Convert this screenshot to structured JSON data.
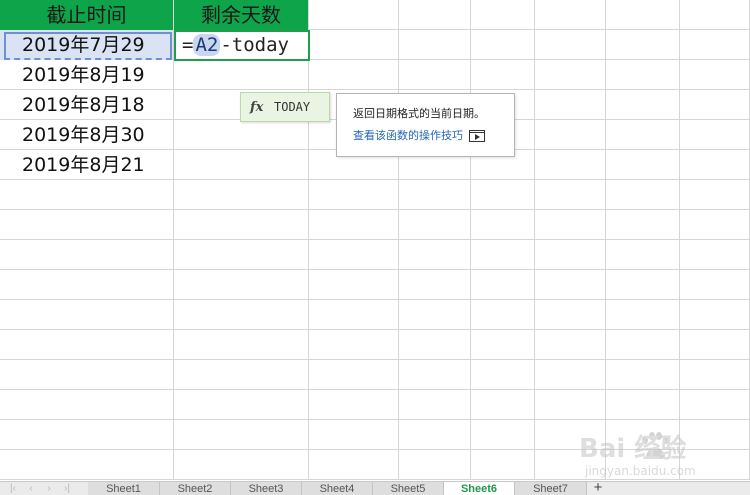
{
  "spreadsheet": {
    "headers": {
      "col_a": "截止时间",
      "col_b": "剩余天数"
    },
    "dates": [
      "2019年7月29",
      "2019年8月19",
      "2019年8月18",
      "2019年8月30",
      "2019年8月21"
    ],
    "formula": {
      "equals": "=",
      "ref": "A2",
      "rest": "-today"
    }
  },
  "autocomplete": {
    "fx_symbol": "fx",
    "function_name": "TODAY"
  },
  "tooltip": {
    "description": "返回日期格式的当前日期。",
    "link_text": "查看该函数的操作技巧"
  },
  "sheet_tabs": [
    "Sheet1",
    "Sheet2",
    "Sheet3",
    "Sheet4",
    "Sheet5",
    "Sheet6",
    "Sheet7"
  ],
  "active_sheet": "Sheet6",
  "add_sheet_symbol": "+",
  "watermark": {
    "brand": "Bai 经验",
    "url": "jingyan.baidu.com"
  },
  "colors": {
    "header_green": "#0ea44a",
    "active_tab_text": "#1f9a4a",
    "ref_highlight": "#dae3f3",
    "link_blue": "#2466b8"
  },
  "icons": {
    "autocomplete": "function-fx-icon",
    "tooltip_link": "video-play-icon",
    "add_sheet": "plus-icon",
    "watermark": "baidu-paw-logo"
  }
}
